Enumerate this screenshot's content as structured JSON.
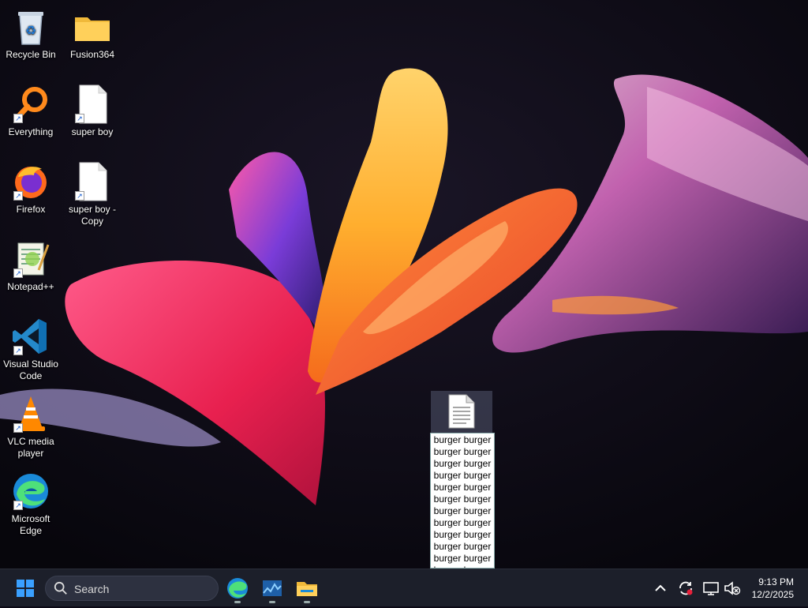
{
  "desktop": {
    "icons": [
      {
        "label": "Recycle Bin",
        "icon": "recycle-bin-icon"
      },
      {
        "label": "Fusion364",
        "icon": "folder-icon"
      },
      {
        "label": "Everything",
        "icon": "everything-icon"
      },
      {
        "label": "super boy",
        "icon": "blank-file-icon"
      },
      {
        "label": "Firefox",
        "icon": "firefox-icon"
      },
      {
        "label": "super boy - Copy",
        "icon": "blank-file-icon"
      },
      {
        "label": "Notepad++",
        "icon": "notepad-plus-plus-icon"
      },
      {
        "label": "Visual Studio Code",
        "icon": "vscode-icon"
      },
      {
        "label": "VLC media player",
        "icon": "vlc-icon"
      },
      {
        "label": "Microsoft Edge",
        "icon": "edge-icon"
      }
    ],
    "selected_file": {
      "icon": "text-file-icon",
      "name_lines": [
        "burger burger",
        "burger burger",
        "burger burger",
        "burger burger",
        "burger burger",
        "burger burger",
        "burger burger",
        "burger burger",
        "burger burger",
        "burger burger",
        "burger burger",
        "burger burger"
      ]
    }
  },
  "taskbar": {
    "start_icon": "windows-start-icon",
    "search": {
      "placeholder": "Search"
    },
    "pinned": [
      {
        "name": "Microsoft Edge",
        "icon": "edge-icon",
        "running": true
      },
      {
        "name": "Task Manager",
        "icon": "task-manager-icon",
        "running": true
      },
      {
        "name": "File Explorer",
        "icon": "file-explorer-icon",
        "running": true
      }
    ],
    "tray": [
      "chevron-up-icon",
      "sync-icon",
      "network-icon",
      "volume-muted-icon"
    ],
    "clock": {
      "time": "9:13 PM",
      "date": "12/2/2025"
    }
  },
  "colors": {
    "taskbar_bg": "#1c1f2a",
    "accent": "#2b8cff"
  }
}
